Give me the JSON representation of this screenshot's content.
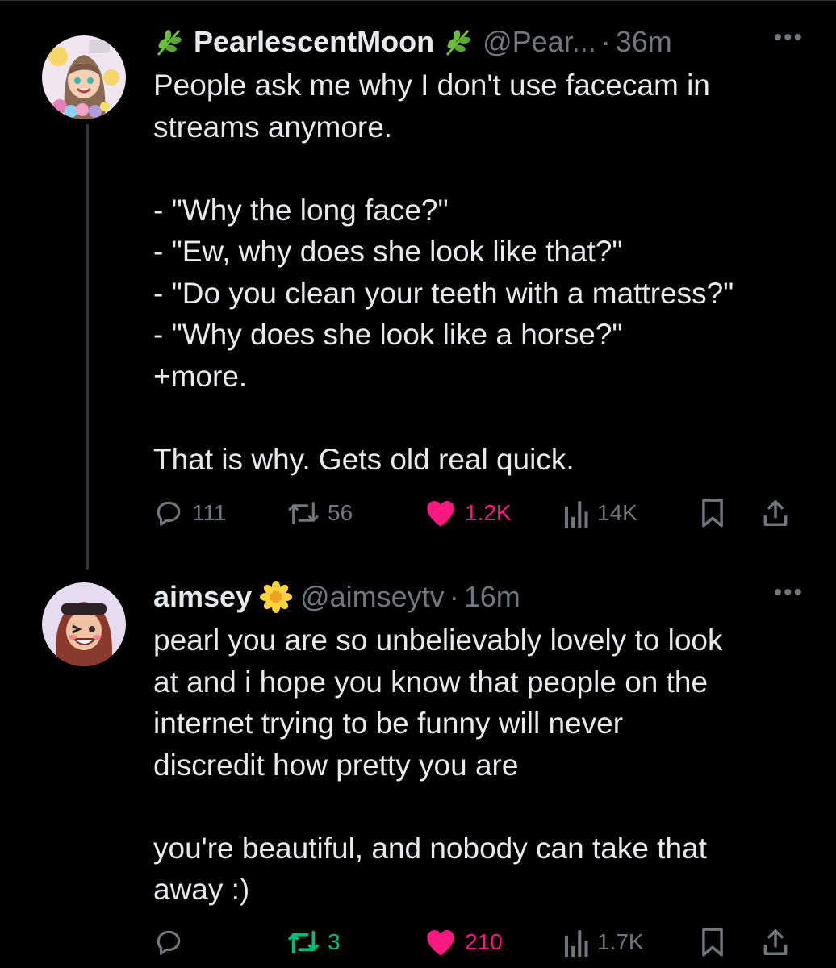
{
  "tweets": [
    {
      "display_name": "PearlescentMoon",
      "handle": "@Pear...",
      "time": "36m",
      "name_emoji": "herb",
      "text": "People ask me why I don't use facecam in\nstreams anymore.\n\n- \"Why the long face?\"\n- \"Ew, why does she look like that?\"\n- \"Do you clean your teeth with a mattress?\"\n- \"Why does she look like a horse?\"\n+more.\n\nThat is why. Gets old real quick.",
      "replies": "111",
      "retweets": "56",
      "likes": "1.2K",
      "views": "14K",
      "liked": true
    },
    {
      "display_name": "aimsey",
      "handle": "@aimseytv",
      "time": "16m",
      "name_emoji": "blossom",
      "text": "pearl you are so unbelievably lovely to look\nat and i hope you know that people on the\ninternet trying to be funny will never\ndiscredit how pretty you are\n\nyou're beautiful, and nobody can take that\naway :)",
      "replies": "",
      "retweets": "3",
      "likes": "210",
      "views": "1.7K",
      "liked": true,
      "retweeted": true
    }
  ],
  "ui": {
    "more_glyph": "•••",
    "dot": "·"
  },
  "colors": {
    "background": "#000000",
    "text": "#e7e9ea",
    "secondary": "#71767b",
    "like": "#f91880",
    "retweet": "#00ba7c"
  }
}
